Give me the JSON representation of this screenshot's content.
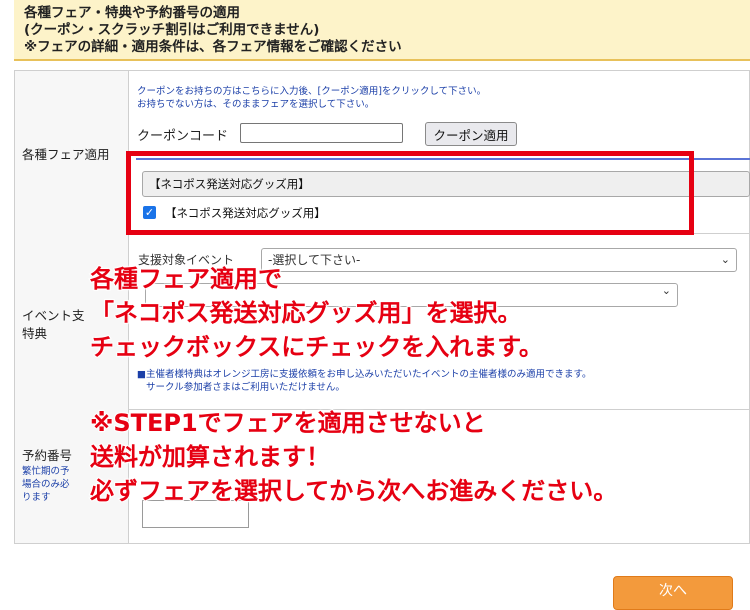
{
  "header": {
    "line1": "各種フェア・特典や予約番号の適用",
    "line2": "(クーポン・スクラッチ割引はご利用できません)",
    "line3": "※フェアの詳細・適用条件は、各フェア情報をご確認ください"
  },
  "fair_row": {
    "label": "各種フェア適用",
    "note1": "クーポンをお持ちの方はこちらに入力後、[クーポン適用]をクリックして下さい。",
    "note2": "お持ちでない方は、そのままフェアを選択して下さい。",
    "coupon_label": "クーポンコード",
    "coupon_value": "",
    "coupon_button": "クーポン適用",
    "fair_select_value": "【ネコポス発送対応グッズ用】",
    "checkbox_label": "【ネコポス発送対応グッズ用】",
    "checkbox_checked": true
  },
  "event_row": {
    "label_line1": "イベント支",
    "label_line2": "特典",
    "target_label_partial": "支援対象イベント",
    "select1_value": "-選択して下さい-",
    "select2_value": "",
    "note1": "■主催者様特典はオレンジ工房に支援依頼をお申し込みいただいたイベントの主催者様のみ適用できます。",
    "note2": "サークル参加者さまはご利用いただけません。"
  },
  "reserve_row": {
    "label": "予約番号",
    "sub1": "繁忙期の予",
    "sub2": "場合のみ必",
    "sub3": "ります",
    "input_value": ""
  },
  "annotation": {
    "block1": [
      "各種フェア適用で",
      "「ネコポス発送対応グッズ用」を選択。",
      "チェックボックスにチェックを入れます。"
    ],
    "block2": [
      "※STEP1でフェアを適用させないと",
      "送料が加算されます！",
      "必ずフェアを選択してから次へお進みください。"
    ],
    "color": "#e60012"
  },
  "next_button": "次へ",
  "colors": {
    "header_bg": "#fdf3c9",
    "accent_orange": "#f39a3c",
    "highlight_red": "#e60012",
    "checkbox_blue": "#1a73e8"
  }
}
